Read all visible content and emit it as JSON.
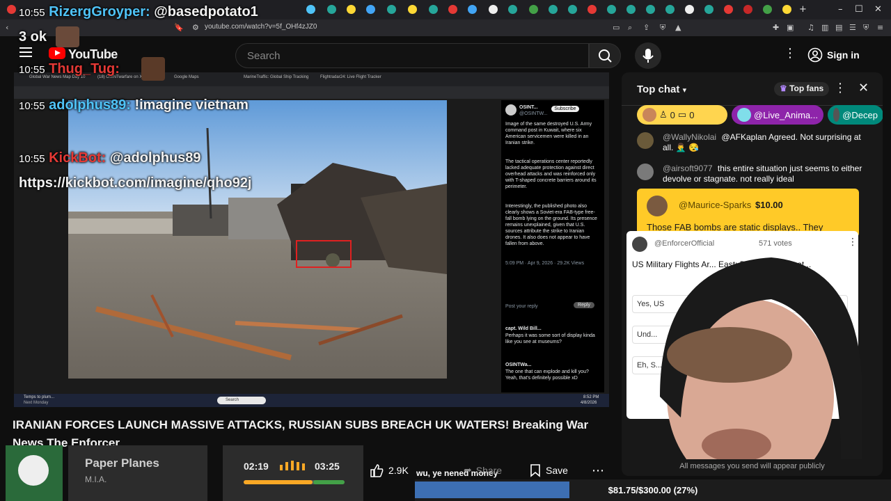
{
  "browser": {
    "url": "youtube.com/watch?v=5f_OHf4zJZ0"
  },
  "youtube": {
    "logo_text": "YouTube",
    "search_placeholder": "Search",
    "sign_in": "Sign in"
  },
  "overlay_chat": [
    {
      "time": "10:55",
      "user": "RizergGroyper:",
      "user_color": "#4fc3f7",
      "text": "@basedpotato1"
    },
    {
      "time": "",
      "user": "3 ok",
      "user_color": "#ffffff",
      "text": ""
    },
    {
      "time": "10:55",
      "user": "Thug_Tug:",
      "user_color": "#e53935",
      "text": ""
    },
    {
      "time": "10:55",
      "user": "adolphus89:",
      "user_color": "#4fc3f7",
      "text": "!imagine vietnam"
    },
    {
      "time": "10:55",
      "user": "KickBot:",
      "user_color": "#e53935",
      "text": "@adolphus89 https://kickbot.com/imagine/qho92j"
    }
  ],
  "video": {
    "inner_tabs": [
      "Global War News Map Day 10",
      "(18) OSINTwarfare on X",
      "Google Maps",
      "MarineTraffic: Global Ship Tracking",
      "Flightradar24: Live Flight Tracker"
    ],
    "tweet": {
      "author": "OSINT...",
      "handle": "@OSINTW...",
      "subscribe": "Subscribe",
      "para1": "Image of the same destroyed U.S. Army command post in Kuwait, where six American servicemen were killed in an Iranian strike.",
      "para2": "The tactical operations center reportedly lacked adequate protection against direct overhead attacks and was reinforced only with T-shaped concrete barriers around its perimeter.",
      "para3": "Interestingly, the published photo also clearly shows a Soviet-era FAB-type free-fall bomb lying on the ground. Its presence remains unexplained, given that U.S. sources attribute the strike to Iranian drones. It also does not appear to have fallen from above.",
      "meta": "5:09 PM · Apr 9, 2026 · 29.2K Views",
      "reply_placeholder": "Post your reply",
      "reply_button": "Reply",
      "reply1_user": "capt. Wild Bill...",
      "reply1_text": "Perhaps it was some sort of display kinda like you see at museums?",
      "reply2_user": "OSINTWa...",
      "reply2_text": "The one that can explode and kill you? Yeah, that's definitely possible xD"
    },
    "taskbar_search": "Search",
    "taskbar_time": "8:52 PM",
    "taskbar_date": "4/8/2026",
    "taskbar_weather": "Temps to plum...",
    "taskbar_weather2": "Next Monday"
  },
  "video_title": "IRANIAN FORCES LAUNCH MASSIVE ATTACKS, RUSSIAN SUBS BREACH UK WATERS! Breaking War News The Enforcer",
  "music": {
    "track": "Paper Planes",
    "artist": "M.I.A.",
    "time_current": "02:19",
    "time_total": "03:25",
    "progress": 0.68
  },
  "actions": {
    "likes": "2.9K",
    "share": "Share",
    "save": "Save",
    "overlay_text": "wu, ye nened money"
  },
  "chat": {
    "title": "Top chat",
    "top_fans": "Top fans",
    "chips": [
      {
        "label": "0",
        "label2": "0",
        "color": "#ffd54f"
      },
      {
        "label": "@Live_Anima...",
        "color": "#8e24aa"
      },
      {
        "label": "@Decep",
        "color": "#00897b"
      }
    ],
    "messages": [
      {
        "user": "@WallyNikolai",
        "text": "@AFKaplan Agreed. Not surprising at all. 🤦‍♂️ 😪"
      },
      {
        "user": "@airsoft9077",
        "text": "this entire situation just seems to either devolve or stagnate. not really ideal"
      }
    ],
    "superchat": {
      "user": "@Maurice-Sparks",
      "amount": "$10.00",
      "text": "Those FAB bombs are static displays.. They"
    },
    "poll": {
      "author": "@EnforcerOfficial",
      "votes": "571 votes",
      "question": "US Military Flights Ar... East; Does This Indicat...",
      "option1": "Yes, US",
      "option2": "Und...",
      "option3": "Eh, S..."
    },
    "footer": "All messages you send will appear publicly"
  },
  "goal": {
    "text": "$81.75/$300.00 (27%)",
    "fraction": 0.27,
    "color": "#3d6fb3"
  }
}
